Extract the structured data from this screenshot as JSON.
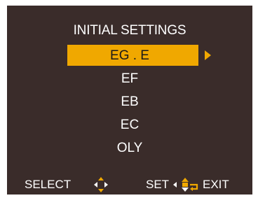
{
  "screen": {
    "title": "INITIAL SETTINGS"
  },
  "menu": {
    "items": [
      {
        "label": "EG . E",
        "selected": true
      },
      {
        "label": "EF",
        "selected": false
      },
      {
        "label": "EB",
        "selected": false
      },
      {
        "label": "EC",
        "selected": false
      },
      {
        "label": "OLY",
        "selected": false
      }
    ]
  },
  "footer": {
    "select_label": "SELECT",
    "set_label": "SET",
    "exit_label": "EXIT"
  },
  "colors": {
    "background": "#3a2c2a",
    "highlight": "#f0a800",
    "text": "#ffffff",
    "selected_text": "#1a1a1a"
  },
  "icons": {
    "select": "dpad-up-down-icon",
    "set": "dpad-set-icon",
    "menu_arrow": "arrow-right-icon"
  }
}
